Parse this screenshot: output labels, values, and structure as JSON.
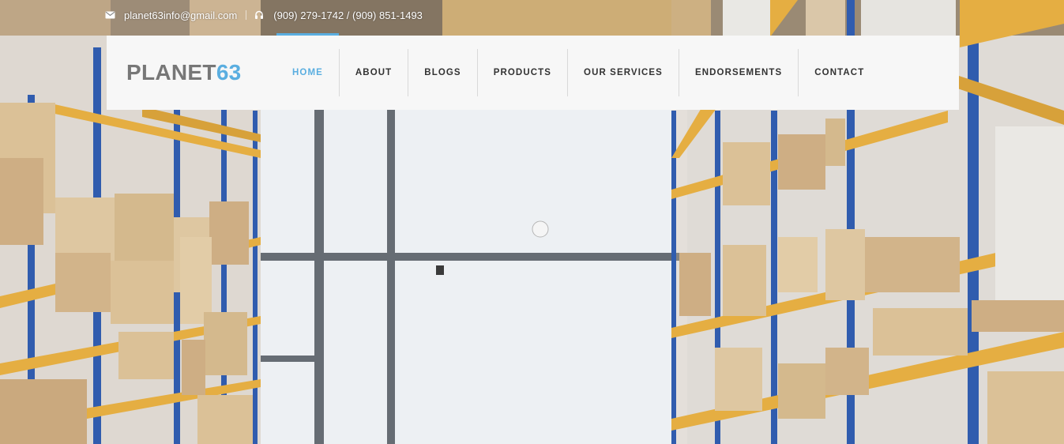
{
  "topbar": {
    "email_icon": "envelope-icon",
    "email": "planet63info@gmail.com",
    "phone_icon": "headset-icon",
    "phones": "(909) 279-1742 / (909) 851-1493"
  },
  "brand": {
    "logo_main": "PLANET",
    "logo_accent": "63",
    "accent_color": "#5aaee0"
  },
  "nav": {
    "items": [
      {
        "label": "HOME",
        "active": true
      },
      {
        "label": "ABOUT"
      },
      {
        "label": "BLOGS"
      },
      {
        "label": "PRODUCTS"
      },
      {
        "label": "OUR SERVICES"
      },
      {
        "label": "ENDORSEMENTS"
      },
      {
        "label": "CONTACT"
      }
    ]
  }
}
